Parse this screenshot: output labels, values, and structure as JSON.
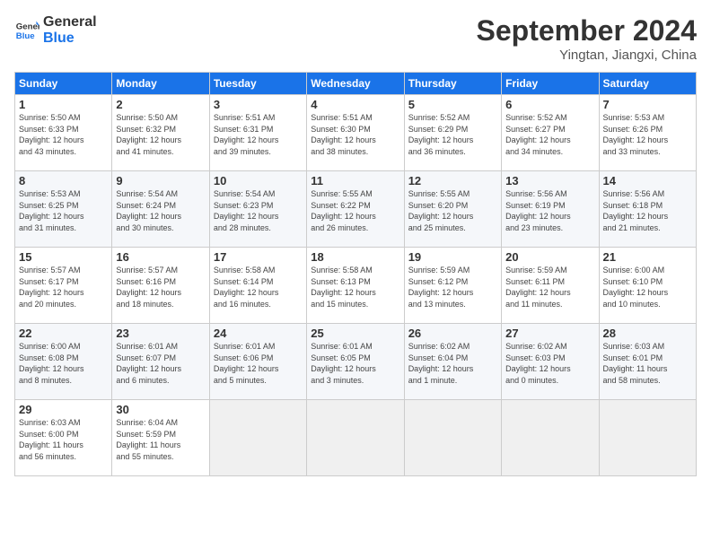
{
  "logo": {
    "line1": "General",
    "line2": "Blue"
  },
  "header": {
    "month": "September 2024",
    "location": "Yingtan, Jiangxi, China"
  },
  "weekdays": [
    "Sunday",
    "Monday",
    "Tuesday",
    "Wednesday",
    "Thursday",
    "Friday",
    "Saturday"
  ],
  "weeks": [
    [
      {
        "day": "1",
        "info": "Sunrise: 5:50 AM\nSunset: 6:33 PM\nDaylight: 12 hours\nand 43 minutes."
      },
      {
        "day": "2",
        "info": "Sunrise: 5:50 AM\nSunset: 6:32 PM\nDaylight: 12 hours\nand 41 minutes."
      },
      {
        "day": "3",
        "info": "Sunrise: 5:51 AM\nSunset: 6:31 PM\nDaylight: 12 hours\nand 39 minutes."
      },
      {
        "day": "4",
        "info": "Sunrise: 5:51 AM\nSunset: 6:30 PM\nDaylight: 12 hours\nand 38 minutes."
      },
      {
        "day": "5",
        "info": "Sunrise: 5:52 AM\nSunset: 6:29 PM\nDaylight: 12 hours\nand 36 minutes."
      },
      {
        "day": "6",
        "info": "Sunrise: 5:52 AM\nSunset: 6:27 PM\nDaylight: 12 hours\nand 34 minutes."
      },
      {
        "day": "7",
        "info": "Sunrise: 5:53 AM\nSunset: 6:26 PM\nDaylight: 12 hours\nand 33 minutes."
      }
    ],
    [
      {
        "day": "8",
        "info": "Sunrise: 5:53 AM\nSunset: 6:25 PM\nDaylight: 12 hours\nand 31 minutes."
      },
      {
        "day": "9",
        "info": "Sunrise: 5:54 AM\nSunset: 6:24 PM\nDaylight: 12 hours\nand 30 minutes."
      },
      {
        "day": "10",
        "info": "Sunrise: 5:54 AM\nSunset: 6:23 PM\nDaylight: 12 hours\nand 28 minutes."
      },
      {
        "day": "11",
        "info": "Sunrise: 5:55 AM\nSunset: 6:22 PM\nDaylight: 12 hours\nand 26 minutes."
      },
      {
        "day": "12",
        "info": "Sunrise: 5:55 AM\nSunset: 6:20 PM\nDaylight: 12 hours\nand 25 minutes."
      },
      {
        "day": "13",
        "info": "Sunrise: 5:56 AM\nSunset: 6:19 PM\nDaylight: 12 hours\nand 23 minutes."
      },
      {
        "day": "14",
        "info": "Sunrise: 5:56 AM\nSunset: 6:18 PM\nDaylight: 12 hours\nand 21 minutes."
      }
    ],
    [
      {
        "day": "15",
        "info": "Sunrise: 5:57 AM\nSunset: 6:17 PM\nDaylight: 12 hours\nand 20 minutes."
      },
      {
        "day": "16",
        "info": "Sunrise: 5:57 AM\nSunset: 6:16 PM\nDaylight: 12 hours\nand 18 minutes."
      },
      {
        "day": "17",
        "info": "Sunrise: 5:58 AM\nSunset: 6:14 PM\nDaylight: 12 hours\nand 16 minutes."
      },
      {
        "day": "18",
        "info": "Sunrise: 5:58 AM\nSunset: 6:13 PM\nDaylight: 12 hours\nand 15 minutes."
      },
      {
        "day": "19",
        "info": "Sunrise: 5:59 AM\nSunset: 6:12 PM\nDaylight: 12 hours\nand 13 minutes."
      },
      {
        "day": "20",
        "info": "Sunrise: 5:59 AM\nSunset: 6:11 PM\nDaylight: 12 hours\nand 11 minutes."
      },
      {
        "day": "21",
        "info": "Sunrise: 6:00 AM\nSunset: 6:10 PM\nDaylight: 12 hours\nand 10 minutes."
      }
    ],
    [
      {
        "day": "22",
        "info": "Sunrise: 6:00 AM\nSunset: 6:08 PM\nDaylight: 12 hours\nand 8 minutes."
      },
      {
        "day": "23",
        "info": "Sunrise: 6:01 AM\nSunset: 6:07 PM\nDaylight: 12 hours\nand 6 minutes."
      },
      {
        "day": "24",
        "info": "Sunrise: 6:01 AM\nSunset: 6:06 PM\nDaylight: 12 hours\nand 5 minutes."
      },
      {
        "day": "25",
        "info": "Sunrise: 6:01 AM\nSunset: 6:05 PM\nDaylight: 12 hours\nand 3 minutes."
      },
      {
        "day": "26",
        "info": "Sunrise: 6:02 AM\nSunset: 6:04 PM\nDaylight: 12 hours\nand 1 minute."
      },
      {
        "day": "27",
        "info": "Sunrise: 6:02 AM\nSunset: 6:03 PM\nDaylight: 12 hours\nand 0 minutes."
      },
      {
        "day": "28",
        "info": "Sunrise: 6:03 AM\nSunset: 6:01 PM\nDaylight: 11 hours\nand 58 minutes."
      }
    ],
    [
      {
        "day": "29",
        "info": "Sunrise: 6:03 AM\nSunset: 6:00 PM\nDaylight: 11 hours\nand 56 minutes."
      },
      {
        "day": "30",
        "info": "Sunrise: 6:04 AM\nSunset: 5:59 PM\nDaylight: 11 hours\nand 55 minutes."
      },
      null,
      null,
      null,
      null,
      null
    ]
  ]
}
